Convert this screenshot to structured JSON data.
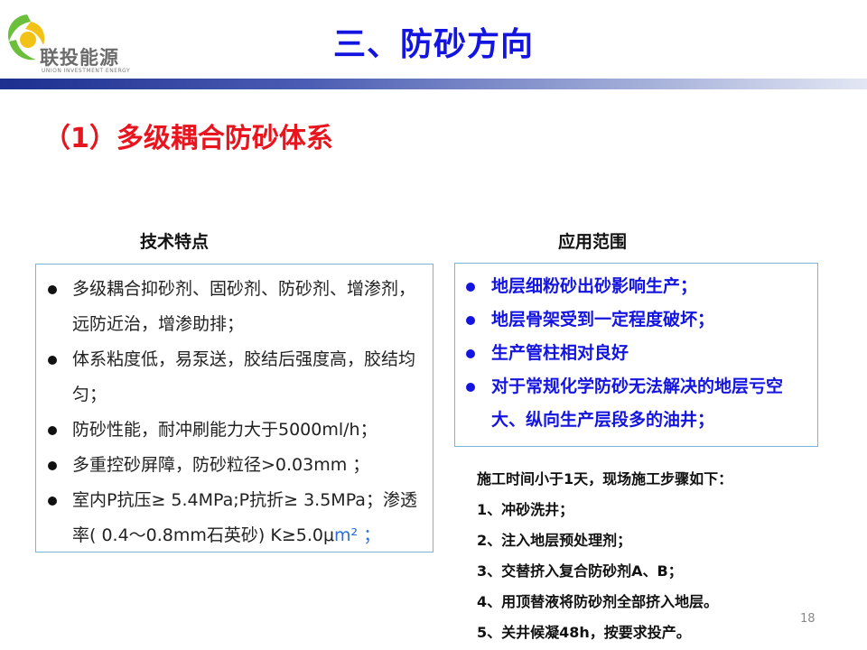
{
  "logo": {
    "name": "联投能源",
    "english": "UNION INVESTMENT ENERGY",
    "colors": {
      "yellow": "#f2c316",
      "green": "#6cbf3a",
      "gray": "#6b6b6b"
    }
  },
  "slide_title": "三、防砂方向",
  "section_title": "（1）多级耦合防砂体系",
  "tech": {
    "heading": "技术特点",
    "items": [
      "多级耦合抑砂剂、固砂剂、防砂剂、增渗剂，远防近治，增渗助排；",
      "体系粘度低，易泵送，胶结后强度高，胶结均匀；",
      "防砂性能，耐冲刷能力大于5000ml/h；",
      "多重控砂屏障，防砂粒径>0.03mm ；",
      "室内P抗压≥ 5.4MPa;P抗折≥ 3.5MPa；渗透率( 0.4～0.8mm石英砂) K≥5.0μ"
    ],
    "last_tail": "m² ；"
  },
  "scope": {
    "heading": "应用范围",
    "items": [
      "地层细粉砂出砂影响生产；",
      "地层骨架受到一定程度破坏；",
      "生产管柱相对良好",
      "对于常规化学防砂无法解决的地层亏空大、纵向生产层段多的油井；"
    ]
  },
  "steps": {
    "intro": "施工时间小于1天，现场施工步骤如下：",
    "items": [
      "1、冲砂洗井；",
      "2、注入地层预处理剂；",
      "3、交替挤入复合防砂剂A、B；",
      "4、用顶替液将防砂剂全部挤入地层。",
      "5、关井候凝48h，按要求投产。"
    ]
  },
  "page_number": "18",
  "colors": {
    "title_blue": "#1414e0",
    "section_red": "#e8141e",
    "box_border": "#7fb0d6"
  }
}
